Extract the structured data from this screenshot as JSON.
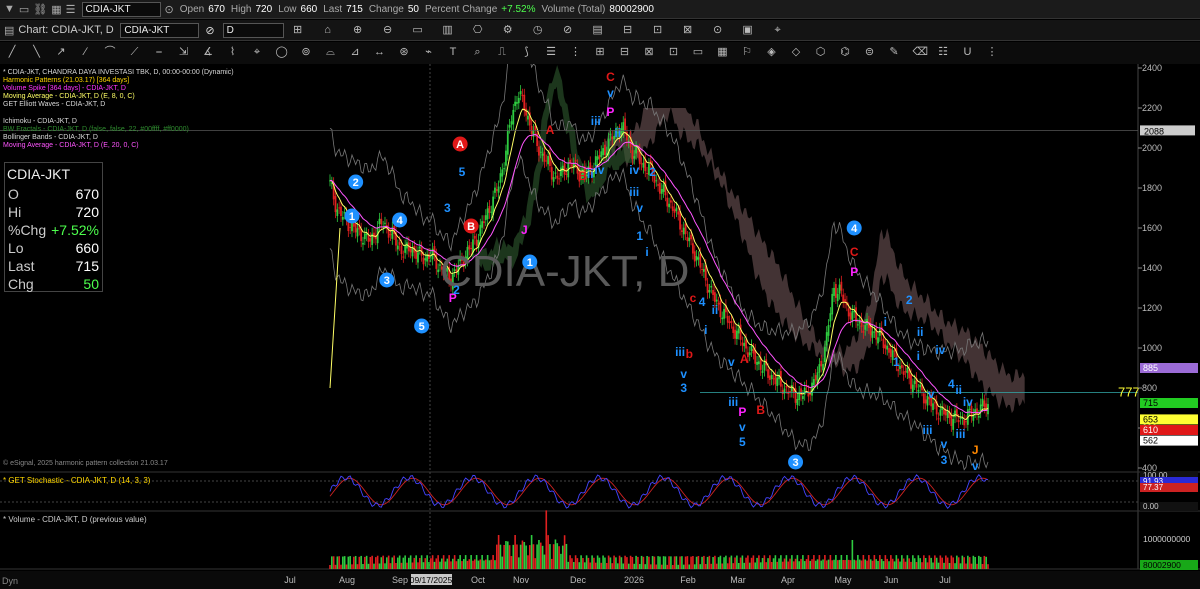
{
  "toolbar": {
    "symbol": "CDIA-JKT",
    "quote": [
      {
        "label": "Open",
        "value": "670"
      },
      {
        "label": "High",
        "value": "720"
      },
      {
        "label": "Low",
        "value": "660"
      },
      {
        "label": "Last",
        "value": "715"
      },
      {
        "label": "Change",
        "value": "50"
      },
      {
        "label": "Percent Change",
        "value": "+7.52%"
      },
      {
        "label": "Volume (Total)",
        "value": "80002900"
      }
    ]
  },
  "chart_window": {
    "title": "Chart: CDIA-JKT, D",
    "symbol_box": "CDIA-JKT",
    "interval_box": "D"
  },
  "watermark": "CDIA-JKT, D",
  "legend": [
    {
      "text": "* CDIA-JKT, CHANDRA DAYA INVESTASI TBK, D, 00:00-00:00 (Dynamic)",
      "color": "#d8d8d8"
    },
    {
      "text": "Harmonic Patterns (21.03.17) [364 days]",
      "color": "#ffd700"
    },
    {
      "text": "Volume Spike [364 days] - CDIA-JKT, D",
      "color": "#ff33ff"
    },
    {
      "text": "Moving Average - CDIA-JKT, D (E, 8, 0, C)",
      "color": "#ffff66"
    },
    {
      "text": "GET Elliott Waves - CDIA-JKT, D",
      "color": "#d8d8d8"
    },
    {
      "text": "Ichimoku - CDIA-JKT, D",
      "color": "#d8d8d8"
    },
    {
      "text": "BW Fractals - CDIA-JKT, D (false, false, 22, #00ffff, #ff0000)",
      "color": "#2e8b2e"
    },
    {
      "text": "Bollinger Bands - CDIA-JKT, D",
      "color": "#d8d8d8"
    },
    {
      "text": "Moving Average - CDIA-JKT, D (E, 20, 0, C)",
      "color": "#ff55ff"
    }
  ],
  "databox": {
    "title": "CDIA-JKT",
    "rows": [
      {
        "label": "O",
        "value": "670"
      },
      {
        "label": "Hi",
        "value": "720"
      },
      {
        "label": "%Chg",
        "value": "+7.52%"
      },
      {
        "label": "Lo",
        "value": "660"
      },
      {
        "label": "Last",
        "value": "715"
      },
      {
        "label": "Chg",
        "value": "50"
      }
    ]
  },
  "copyright": "© eSignal, 2025 harmonic pattern collection 21.03.17",
  "panels": {
    "stochastic_title": "* GET Stochastic - CDIA-JKT, D (14, 3, 3)",
    "volume_title": "* Volume - CDIA-JKT, D (previous value)"
  },
  "price_labels": [
    {
      "value": "885",
      "bg": "#9b6bd6",
      "fg": "#ffffff"
    },
    {
      "value": "715",
      "bg": "#22cc22",
      "fg": "#000000"
    },
    {
      "value": "653",
      "bg": "#ffff33",
      "fg": "#000000"
    },
    {
      "value": "610",
      "bg": "#e01818",
      "fg": "#ffffff"
    },
    {
      "value": "562",
      "bg": "#ffffff",
      "fg": "#000000"
    }
  ],
  "reference_lines": [
    {
      "label": "2088",
      "value": 2088
    },
    {
      "label": "777",
      "value": 777
    }
  ],
  "stoch_labels": [
    {
      "value": "100.00",
      "bg": "#111111",
      "fg": "#cccccc"
    },
    {
      "value": "91.93",
      "bg": "#2a2ad6",
      "fg": "#ffffff"
    },
    {
      "value": "77.37",
      "bg": "#cc2222",
      "fg": "#ffffff"
    },
    {
      "value": "0.00",
      "bg": "#111111",
      "fg": "#cccccc"
    }
  ],
  "volume_labels": [
    {
      "value": "1000000000",
      "bg": "#000000",
      "fg": "#cccccc"
    },
    {
      "value": "80002900",
      "bg": "#18a818",
      "fg": "#000000"
    }
  ],
  "date_marker": "09/17/2025",
  "footer_tag": "Dyn",
  "annotations": [
    {
      "t": "1",
      "s": "circle",
      "c": "#1e90ff",
      "v": 1660,
      "i": 12
    },
    {
      "t": "2",
      "s": "circle",
      "c": "#1e90ff",
      "v": 1830,
      "i": 14
    },
    {
      "t": "3",
      "s": "circle",
      "c": "#1e90ff",
      "v": 1340,
      "i": 31
    },
    {
      "t": "4",
      "s": "circle",
      "c": "#1e90ff",
      "v": 1640,
      "i": 38
    },
    {
      "t": "5",
      "s": "circle",
      "c": "#1e90ff",
      "v": 1110,
      "i": 50
    },
    {
      "t": "1",
      "s": "circle",
      "c": "#1e90ff",
      "v": 1430,
      "i": 109
    },
    {
      "t": "4",
      "s": "circle",
      "c": "#1e90ff",
      "v": 1600,
      "i": 286
    },
    {
      "t": "3",
      "s": "circle",
      "c": "#1e90ff",
      "v": 430,
      "i": 254
    },
    {
      "t": "A",
      "s": "circle",
      "c": "#e01818",
      "v": 2020,
      "i": 71
    },
    {
      "t": "B",
      "s": "circle",
      "c": "#e01818",
      "v": 1610,
      "i": 77
    },
    {
      "t": "C",
      "s": "text",
      "c": "#e01818",
      "v": 2355,
      "i": 153
    },
    {
      "t": "v",
      "s": "text",
      "c": "#1e90ff",
      "v": 2275,
      "i": 153
    },
    {
      "t": "P",
      "s": "text",
      "c": "#ff22ff",
      "v": 2180,
      "i": 153
    },
    {
      "t": "P",
      "s": "text",
      "c": "#ff22ff",
      "v": 1250,
      "i": 67
    },
    {
      "t": "2",
      "s": "text",
      "c": "#1e90ff",
      "v": 1290,
      "i": 69
    },
    {
      "t": "3",
      "s": "text",
      "c": "#1e90ff",
      "v": 1700,
      "i": 64
    },
    {
      "t": "5",
      "s": "text",
      "c": "#1e90ff",
      "v": 1880,
      "i": 72
    },
    {
      "t": "A",
      "s": "text",
      "c": "#e01818",
      "v": 2090,
      "i": 120
    },
    {
      "t": "B",
      "s": "text",
      "c": "#e01818",
      "v": 1860,
      "i": 138
    },
    {
      "t": "J",
      "s": "text",
      "c": "#ff22ff",
      "v": 1590,
      "i": 106
    },
    {
      "t": "iii",
      "s": "text",
      "c": "#1e90ff",
      "v": 2135,
      "i": 145
    },
    {
      "t": "ii",
      "s": "text",
      "c": "#1e90ff",
      "v": 2075,
      "i": 157
    },
    {
      "t": "iv",
      "s": "text",
      "c": "#1e90ff",
      "v": 1890,
      "i": 147
    },
    {
      "t": "ii",
      "s": "text",
      "c": "#1e90ff",
      "v": 1870,
      "i": 142
    },
    {
      "t": "2",
      "s": "text",
      "c": "#1e90ff",
      "v": 1880,
      "i": 176
    },
    {
      "t": "iv",
      "s": "text",
      "c": "#1e90ff",
      "v": 1890,
      "i": 166
    },
    {
      "t": "iii",
      "s": "text",
      "c": "#1e90ff",
      "v": 1780,
      "i": 166
    },
    {
      "t": "v",
      "s": "text",
      "c": "#1e90ff",
      "v": 1700,
      "i": 169
    },
    {
      "t": "1",
      "s": "text",
      "c": "#1e90ff",
      "v": 1560,
      "i": 169
    },
    {
      "t": "i",
      "s": "text",
      "c": "#1e90ff",
      "v": 1480,
      "i": 173
    },
    {
      "t": "iii",
      "s": "text",
      "c": "#1e90ff",
      "v": 980,
      "i": 191
    },
    {
      "t": "b",
      "s": "text",
      "c": "#e01818",
      "v": 970,
      "i": 196
    },
    {
      "t": "v",
      "s": "text",
      "c": "#1e90ff",
      "v": 870,
      "i": 193
    },
    {
      "t": "3",
      "s": "text",
      "c": "#1e90ff",
      "v": 800,
      "i": 193
    },
    {
      "t": "c",
      "s": "text",
      "c": "#e01818",
      "v": 1250,
      "i": 198
    },
    {
      "t": "4",
      "s": "text",
      "c": "#1e90ff",
      "v": 1230,
      "i": 203
    },
    {
      "t": "ii",
      "s": "text",
      "c": "#1e90ff",
      "v": 1190,
      "i": 210
    },
    {
      "t": "i",
      "s": "text",
      "c": "#1e90ff",
      "v": 1090,
      "i": 205
    },
    {
      "t": "v",
      "s": "text",
      "c": "#1e90ff",
      "v": 930,
      "i": 219
    },
    {
      "t": "A",
      "s": "text",
      "c": "#e01818",
      "v": 945,
      "i": 226
    },
    {
      "t": "iii",
      "s": "text",
      "c": "#1e90ff",
      "v": 730,
      "i": 220
    },
    {
      "t": "P",
      "s": "text",
      "c": "#ff22ff",
      "v": 680,
      "i": 225
    },
    {
      "t": "B",
      "s": "text",
      "c": "#e01818",
      "v": 690,
      "i": 235
    },
    {
      "t": "v",
      "s": "text",
      "c": "#1e90ff",
      "v": 605,
      "i": 225
    },
    {
      "t": "5",
      "s": "text",
      "c": "#1e90ff",
      "v": 530,
      "i": 225
    },
    {
      "t": "C",
      "s": "text",
      "c": "#e01818",
      "v": 1480,
      "i": 286
    },
    {
      "t": "P",
      "s": "text",
      "c": "#ff22ff",
      "v": 1380,
      "i": 286
    },
    {
      "t": "2",
      "s": "text",
      "c": "#1e90ff",
      "v": 1240,
      "i": 316
    },
    {
      "t": "ii",
      "s": "text",
      "c": "#1e90ff",
      "v": 1080,
      "i": 322
    },
    {
      "t": "i",
      "s": "text",
      "c": "#1e90ff",
      "v": 1130,
      "i": 303
    },
    {
      "t": "i",
      "s": "text",
      "c": "#1e90ff",
      "v": 960,
      "i": 321
    },
    {
      "t": "1",
      "s": "text",
      "c": "#1e90ff",
      "v": 930,
      "i": 309
    },
    {
      "t": "iv",
      "s": "text",
      "c": "#1e90ff",
      "v": 990,
      "i": 333
    },
    {
      "t": "4",
      "s": "text",
      "c": "#1e90ff",
      "v": 820,
      "i": 339
    },
    {
      "t": "ii",
      "s": "text",
      "c": "#1e90ff",
      "v": 790,
      "i": 343
    },
    {
      "t": "iv",
      "s": "text",
      "c": "#1e90ff",
      "v": 730,
      "i": 348
    },
    {
      "t": "v",
      "s": "text",
      "c": "#1e90ff",
      "v": 770,
      "i": 328
    },
    {
      "t": "iii",
      "s": "text",
      "c": "#1e90ff",
      "v": 590,
      "i": 326
    },
    {
      "t": "v",
      "s": "text",
      "c": "#1e90ff",
      "v": 520,
      "i": 335
    },
    {
      "t": "3",
      "s": "text",
      "c": "#1e90ff",
      "v": 440,
      "i": 335
    },
    {
      "t": "iii",
      "s": "text",
      "c": "#1e90ff",
      "v": 570,
      "i": 344
    },
    {
      "t": "J",
      "s": "text",
      "c": "#ff8800",
      "v": 490,
      "i": 352
    },
    {
      "t": "v",
      "s": "text",
      "c": "#1e90ff",
      "v": 410,
      "i": 352
    }
  ],
  "chart_data": {
    "type": "candlestick",
    "x_axis_labels": [
      "Jul",
      "Aug",
      "Sep",
      "Oct",
      "Nov",
      "Dec",
      "2026",
      "Feb",
      "Mar",
      "Apr",
      "May",
      "Jun",
      "Jul"
    ],
    "y_axis": {
      "ticks": [
        2400,
        2200,
        2000,
        1800,
        1600,
        1400,
        1200,
        1000,
        800,
        600,
        400
      ],
      "ylim": [
        380,
        2420
      ]
    },
    "stochastic_axis": {
      "ticks": [
        "100.00",
        "0.00"
      ]
    },
    "volume_axis": {
      "ticks": [
        "1000000000"
      ]
    },
    "series": [
      {
        "name": "Price",
        "close": [
          1820,
          1700,
          1650,
          1620,
          1580,
          1560,
          1530,
          1600,
          1620,
          1580,
          1520,
          1480,
          1500,
          1470,
          1450,
          1470,
          1420,
          1380,
          1350,
          1400,
          1460,
          1500,
          1560,
          1640,
          1720,
          1800,
          1950,
          2150,
          2280,
          2200,
          2100,
          2000,
          1950,
          1880,
          1850,
          1900,
          1920,
          1880,
          1860,
          1900,
          1950,
          2000,
          2050,
          2100,
          2080,
          1980,
          1950,
          1900,
          1880,
          1800,
          1760,
          1700,
          1640,
          1560,
          1500,
          1420,
          1340,
          1260,
          1200,
          1150,
          1100,
          1050,
          1000,
          960,
          920,
          880,
          850,
          820,
          790,
          770,
          760,
          780,
          820,
          900,
          1050,
          1300,
          1280,
          1200,
          1150,
          1120,
          1100,
          1080,
          1050,
          1000,
          950,
          900,
          860,
          820,
          780,
          740,
          700,
          680,
          660,
          650,
          640,
          660,
          680,
          700,
          715
        ]
      }
    ],
    "reference_values": {
      "ichimoku_level": 885,
      "last": 715,
      "ma8": 653,
      "ma20": 610,
      "lower_band": 562,
      "level_2088": 2088,
      "level_777": 777
    }
  }
}
